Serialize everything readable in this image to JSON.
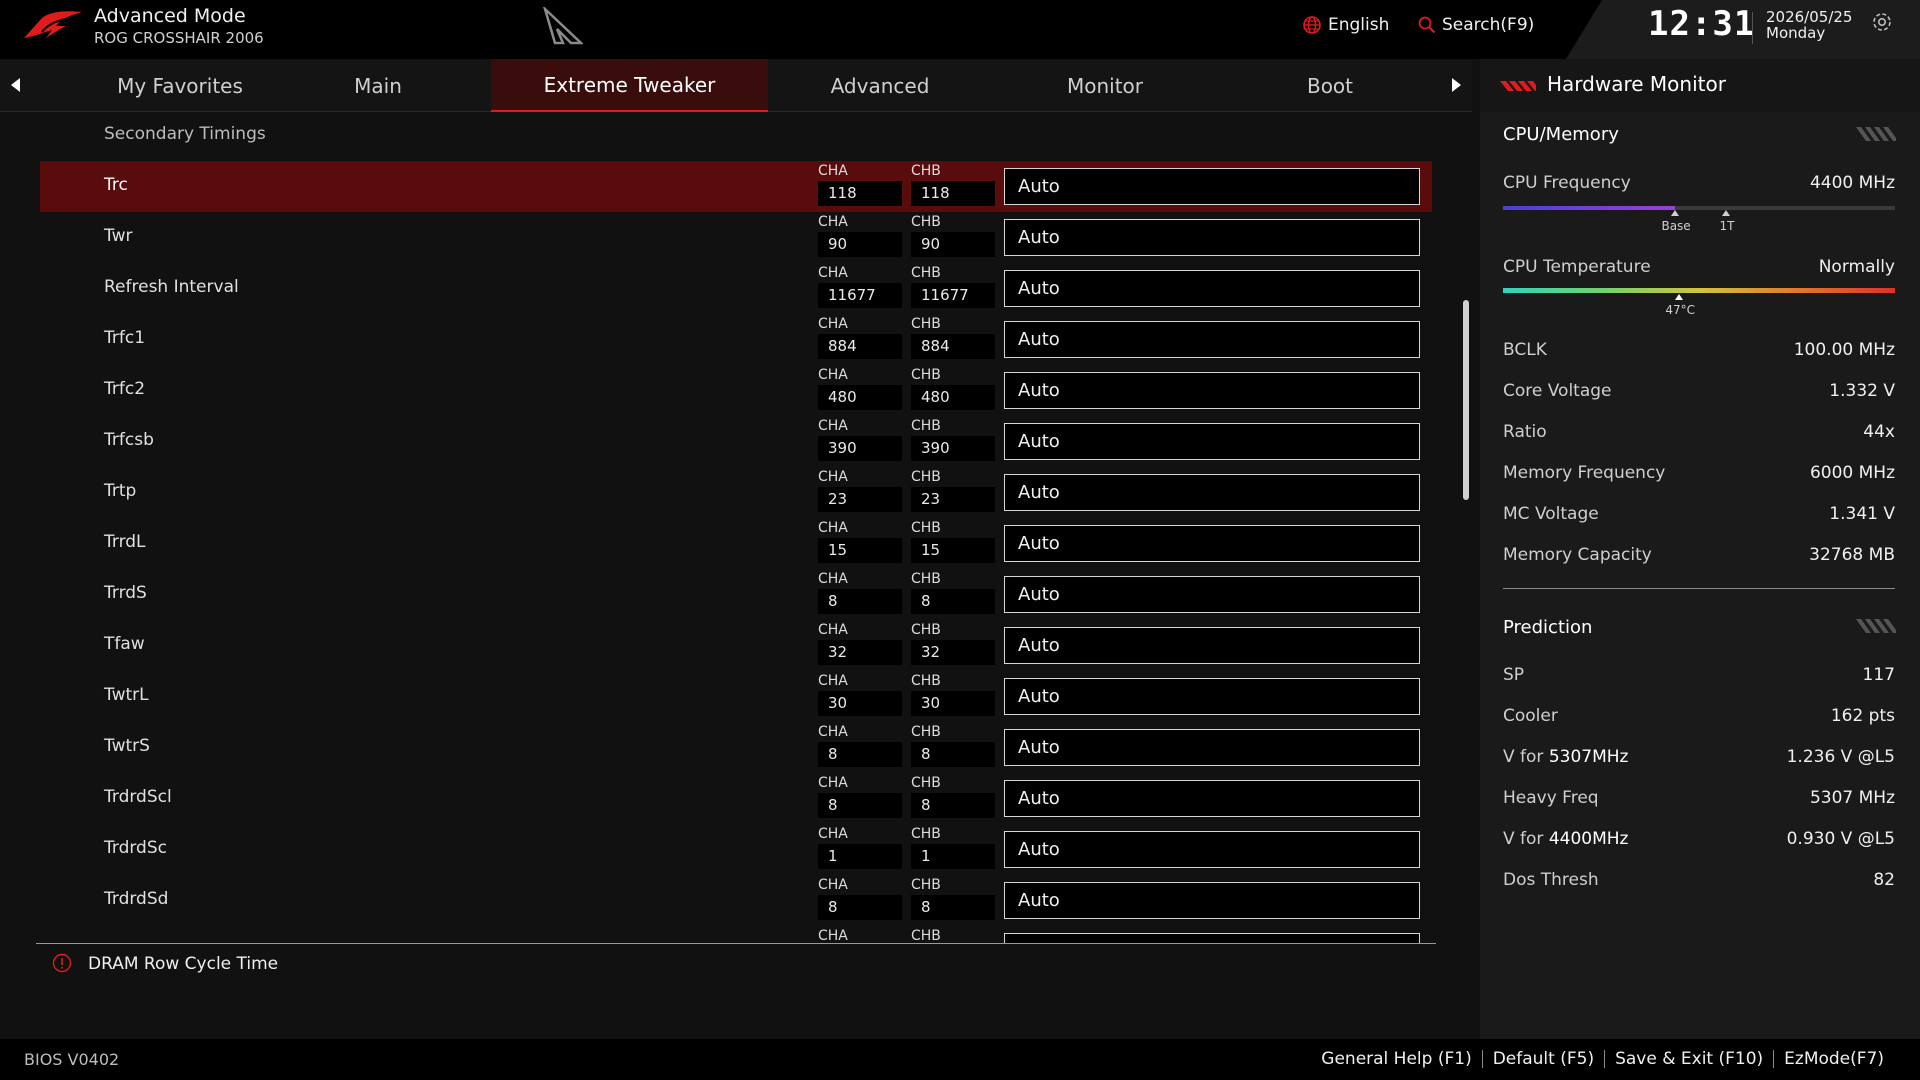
{
  "header": {
    "mode_title": "Advanced Mode",
    "board_name": "ROG CROSSHAIR 2006",
    "language": "English",
    "search": "Search(F9)",
    "clock": "12:31",
    "date": "2026/05/25",
    "weekday": "Monday"
  },
  "tabs": [
    {
      "label": "My Favorites",
      "active": false
    },
    {
      "label": "Main",
      "active": false
    },
    {
      "label": "Extreme Tweaker",
      "active": true
    },
    {
      "label": "Advanced",
      "active": false
    },
    {
      "label": "Monitor",
      "active": false
    },
    {
      "label": "Boot",
      "active": false
    }
  ],
  "list": {
    "section_title": "Secondary Timings",
    "channel_a_label": "CHA",
    "channel_b_label": "CHB",
    "rows": [
      {
        "label": "Trc",
        "cha": "118",
        "chb": "118",
        "value": "Auto",
        "selected": true
      },
      {
        "label": "Twr",
        "cha": "90",
        "chb": "90",
        "value": "Auto",
        "selected": false
      },
      {
        "label": "Refresh Interval",
        "cha": "11677",
        "chb": "11677",
        "value": "Auto",
        "selected": false
      },
      {
        "label": "Trfc1",
        "cha": "884",
        "chb": "884",
        "value": "Auto",
        "selected": false
      },
      {
        "label": "Trfc2",
        "cha": "480",
        "chb": "480",
        "value": "Auto",
        "selected": false
      },
      {
        "label": "Trfcsb",
        "cha": "390",
        "chb": "390",
        "value": "Auto",
        "selected": false
      },
      {
        "label": "Trtp",
        "cha": "23",
        "chb": "23",
        "value": "Auto",
        "selected": false
      },
      {
        "label": "TrrdL",
        "cha": "15",
        "chb": "15",
        "value": "Auto",
        "selected": false
      },
      {
        "label": "TrrdS",
        "cha": "8",
        "chb": "8",
        "value": "Auto",
        "selected": false
      },
      {
        "label": "Tfaw",
        "cha": "32",
        "chb": "32",
        "value": "Auto",
        "selected": false
      },
      {
        "label": "TwtrL",
        "cha": "30",
        "chb": "30",
        "value": "Auto",
        "selected": false
      },
      {
        "label": "TwtrS",
        "cha": "8",
        "chb": "8",
        "value": "Auto",
        "selected": false
      },
      {
        "label": "TrdrdScl",
        "cha": "8",
        "chb": "8",
        "value": "Auto",
        "selected": false
      },
      {
        "label": "TrdrdSc",
        "cha": "1",
        "chb": "1",
        "value": "Auto",
        "selected": false
      },
      {
        "label": "TrdrdSd",
        "cha": "8",
        "chb": "8",
        "value": "Auto",
        "selected": false
      }
    ]
  },
  "help_text": "DRAM Row Cycle Time",
  "hardware_monitor": {
    "title": "Hardware Monitor",
    "cpu_memory": {
      "title": "CPU/Memory",
      "cpu_frequency": {
        "label": "CPU Frequency",
        "value": "4400 MHz",
        "fill_fraction": 0.44,
        "base_label": "Base",
        "base_fraction": 0.44,
        "tt_label": "1T",
        "tt_fraction": 0.57
      },
      "cpu_temperature": {
        "label": "CPU Temperature",
        "value": "Normally",
        "marker_label": "47°C",
        "marker_fraction": 0.45
      },
      "items": [
        {
          "label": "BCLK",
          "value": "100.00 MHz"
        },
        {
          "label": "Core Voltage",
          "value": "1.332 V"
        },
        {
          "label": "Ratio",
          "value": "44x"
        },
        {
          "label": "Memory Frequency",
          "value": "6000 MHz"
        },
        {
          "label": "MC Voltage",
          "value": "1.341 V"
        },
        {
          "label": "Memory Capacity",
          "value": "32768 MB"
        }
      ]
    },
    "prediction": {
      "title": "Prediction",
      "items": [
        {
          "label": "SP",
          "label_bold": "",
          "value": "117"
        },
        {
          "label": "Cooler",
          "label_bold": "",
          "value": "162 pts"
        },
        {
          "label": "V for ",
          "label_bold": "5307MHz",
          "value": "1.236 V @L5"
        },
        {
          "label": "Heavy Freq",
          "label_bold": "",
          "value": "5307 MHz"
        },
        {
          "label": "V for ",
          "label_bold": "4400MHz",
          "value": "0.930 V @L5"
        },
        {
          "label": "Dos Thresh",
          "label_bold": "",
          "value": "82"
        }
      ]
    }
  },
  "footer": {
    "bios_version": "BIOS V0402",
    "keys": [
      "General Help (F1)",
      "Default (F5)",
      "Save & Exit (F10)",
      "EzMode(F7)"
    ]
  },
  "colors": {
    "accent_red": "#e01b1b",
    "selected_row": "#5a0b0b",
    "active_tab": "#3a0d0d"
  }
}
